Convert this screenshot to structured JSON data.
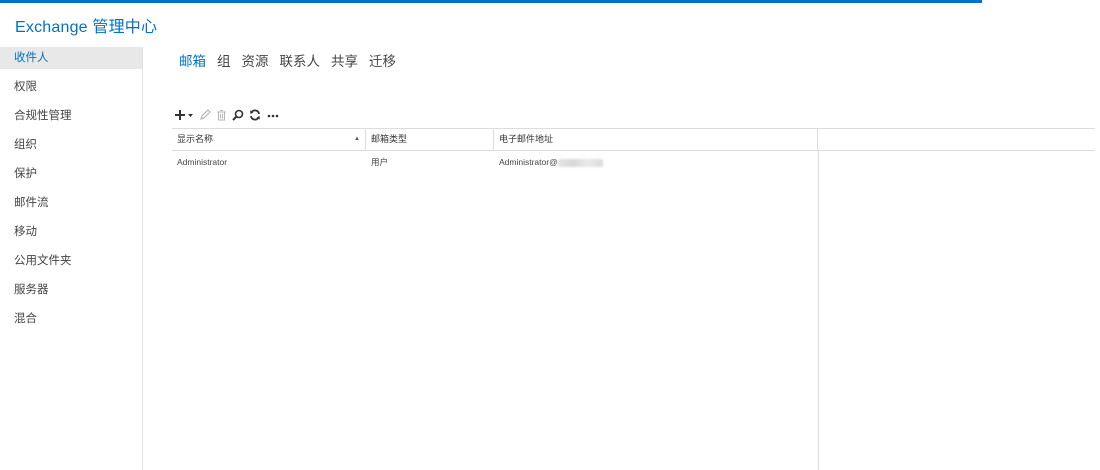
{
  "app": {
    "title": "Exchange 管理中心"
  },
  "progress": {
    "fraction": 0.893
  },
  "sidebar": {
    "items": [
      {
        "label": "收件人",
        "active": true
      },
      {
        "label": "权限"
      },
      {
        "label": "合规性管理"
      },
      {
        "label": "组织"
      },
      {
        "label": "保护"
      },
      {
        "label": "邮件流"
      },
      {
        "label": "移动"
      },
      {
        "label": "公用文件夹"
      },
      {
        "label": "服务器"
      },
      {
        "label": "混合"
      }
    ]
  },
  "tabs": [
    {
      "label": "邮箱",
      "active": true
    },
    {
      "label": "组"
    },
    {
      "label": "资源"
    },
    {
      "label": "联系人"
    },
    {
      "label": "共享"
    },
    {
      "label": "迁移"
    }
  ],
  "toolbar": {
    "icons": [
      "add-icon",
      "edit-icon",
      "delete-icon",
      "search-icon",
      "refresh-icon",
      "more-icon"
    ]
  },
  "table": {
    "headers": [
      "显示名称",
      "邮箱类型",
      "电子邮件地址"
    ],
    "sort_indicator": "▲",
    "rows": [
      {
        "display_name": "Administrator",
        "mailbox_type": "用户",
        "email": "Administrator@"
      }
    ]
  }
}
